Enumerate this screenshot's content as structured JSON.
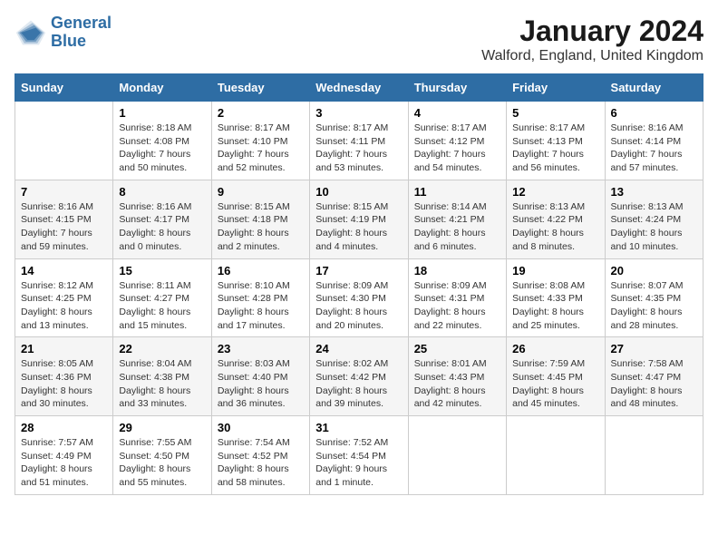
{
  "logo": {
    "line1": "General",
    "line2": "Blue"
  },
  "title": "January 2024",
  "location": "Walford, England, United Kingdom",
  "weekdays": [
    "Sunday",
    "Monday",
    "Tuesday",
    "Wednesday",
    "Thursday",
    "Friday",
    "Saturday"
  ],
  "weeks": [
    [
      {
        "day": "",
        "sunrise": "",
        "sunset": "",
        "daylight": ""
      },
      {
        "day": "1",
        "sunrise": "Sunrise: 8:18 AM",
        "sunset": "Sunset: 4:08 PM",
        "daylight": "Daylight: 7 hours and 50 minutes."
      },
      {
        "day": "2",
        "sunrise": "Sunrise: 8:17 AM",
        "sunset": "Sunset: 4:10 PM",
        "daylight": "Daylight: 7 hours and 52 minutes."
      },
      {
        "day": "3",
        "sunrise": "Sunrise: 8:17 AM",
        "sunset": "Sunset: 4:11 PM",
        "daylight": "Daylight: 7 hours and 53 minutes."
      },
      {
        "day": "4",
        "sunrise": "Sunrise: 8:17 AM",
        "sunset": "Sunset: 4:12 PM",
        "daylight": "Daylight: 7 hours and 54 minutes."
      },
      {
        "day": "5",
        "sunrise": "Sunrise: 8:17 AM",
        "sunset": "Sunset: 4:13 PM",
        "daylight": "Daylight: 7 hours and 56 minutes."
      },
      {
        "day": "6",
        "sunrise": "Sunrise: 8:16 AM",
        "sunset": "Sunset: 4:14 PM",
        "daylight": "Daylight: 7 hours and 57 minutes."
      }
    ],
    [
      {
        "day": "7",
        "sunrise": "Sunrise: 8:16 AM",
        "sunset": "Sunset: 4:15 PM",
        "daylight": "Daylight: 7 hours and 59 minutes."
      },
      {
        "day": "8",
        "sunrise": "Sunrise: 8:16 AM",
        "sunset": "Sunset: 4:17 PM",
        "daylight": "Daylight: 8 hours and 0 minutes."
      },
      {
        "day": "9",
        "sunrise": "Sunrise: 8:15 AM",
        "sunset": "Sunset: 4:18 PM",
        "daylight": "Daylight: 8 hours and 2 minutes."
      },
      {
        "day": "10",
        "sunrise": "Sunrise: 8:15 AM",
        "sunset": "Sunset: 4:19 PM",
        "daylight": "Daylight: 8 hours and 4 minutes."
      },
      {
        "day": "11",
        "sunrise": "Sunrise: 8:14 AM",
        "sunset": "Sunset: 4:21 PM",
        "daylight": "Daylight: 8 hours and 6 minutes."
      },
      {
        "day": "12",
        "sunrise": "Sunrise: 8:13 AM",
        "sunset": "Sunset: 4:22 PM",
        "daylight": "Daylight: 8 hours and 8 minutes."
      },
      {
        "day": "13",
        "sunrise": "Sunrise: 8:13 AM",
        "sunset": "Sunset: 4:24 PM",
        "daylight": "Daylight: 8 hours and 10 minutes."
      }
    ],
    [
      {
        "day": "14",
        "sunrise": "Sunrise: 8:12 AM",
        "sunset": "Sunset: 4:25 PM",
        "daylight": "Daylight: 8 hours and 13 minutes."
      },
      {
        "day": "15",
        "sunrise": "Sunrise: 8:11 AM",
        "sunset": "Sunset: 4:27 PM",
        "daylight": "Daylight: 8 hours and 15 minutes."
      },
      {
        "day": "16",
        "sunrise": "Sunrise: 8:10 AM",
        "sunset": "Sunset: 4:28 PM",
        "daylight": "Daylight: 8 hours and 17 minutes."
      },
      {
        "day": "17",
        "sunrise": "Sunrise: 8:09 AM",
        "sunset": "Sunset: 4:30 PM",
        "daylight": "Daylight: 8 hours and 20 minutes."
      },
      {
        "day": "18",
        "sunrise": "Sunrise: 8:09 AM",
        "sunset": "Sunset: 4:31 PM",
        "daylight": "Daylight: 8 hours and 22 minutes."
      },
      {
        "day": "19",
        "sunrise": "Sunrise: 8:08 AM",
        "sunset": "Sunset: 4:33 PM",
        "daylight": "Daylight: 8 hours and 25 minutes."
      },
      {
        "day": "20",
        "sunrise": "Sunrise: 8:07 AM",
        "sunset": "Sunset: 4:35 PM",
        "daylight": "Daylight: 8 hours and 28 minutes."
      }
    ],
    [
      {
        "day": "21",
        "sunrise": "Sunrise: 8:05 AM",
        "sunset": "Sunset: 4:36 PM",
        "daylight": "Daylight: 8 hours and 30 minutes."
      },
      {
        "day": "22",
        "sunrise": "Sunrise: 8:04 AM",
        "sunset": "Sunset: 4:38 PM",
        "daylight": "Daylight: 8 hours and 33 minutes."
      },
      {
        "day": "23",
        "sunrise": "Sunrise: 8:03 AM",
        "sunset": "Sunset: 4:40 PM",
        "daylight": "Daylight: 8 hours and 36 minutes."
      },
      {
        "day": "24",
        "sunrise": "Sunrise: 8:02 AM",
        "sunset": "Sunset: 4:42 PM",
        "daylight": "Daylight: 8 hours and 39 minutes."
      },
      {
        "day": "25",
        "sunrise": "Sunrise: 8:01 AM",
        "sunset": "Sunset: 4:43 PM",
        "daylight": "Daylight: 8 hours and 42 minutes."
      },
      {
        "day": "26",
        "sunrise": "Sunrise: 7:59 AM",
        "sunset": "Sunset: 4:45 PM",
        "daylight": "Daylight: 8 hours and 45 minutes."
      },
      {
        "day": "27",
        "sunrise": "Sunrise: 7:58 AM",
        "sunset": "Sunset: 4:47 PM",
        "daylight": "Daylight: 8 hours and 48 minutes."
      }
    ],
    [
      {
        "day": "28",
        "sunrise": "Sunrise: 7:57 AM",
        "sunset": "Sunset: 4:49 PM",
        "daylight": "Daylight: 8 hours and 51 minutes."
      },
      {
        "day": "29",
        "sunrise": "Sunrise: 7:55 AM",
        "sunset": "Sunset: 4:50 PM",
        "daylight": "Daylight: 8 hours and 55 minutes."
      },
      {
        "day": "30",
        "sunrise": "Sunrise: 7:54 AM",
        "sunset": "Sunset: 4:52 PM",
        "daylight": "Daylight: 8 hours and 58 minutes."
      },
      {
        "day": "31",
        "sunrise": "Sunrise: 7:52 AM",
        "sunset": "Sunset: 4:54 PM",
        "daylight": "Daylight: 9 hours and 1 minute."
      },
      {
        "day": "",
        "sunrise": "",
        "sunset": "",
        "daylight": ""
      },
      {
        "day": "",
        "sunrise": "",
        "sunset": "",
        "daylight": ""
      },
      {
        "day": "",
        "sunrise": "",
        "sunset": "",
        "daylight": ""
      }
    ]
  ]
}
